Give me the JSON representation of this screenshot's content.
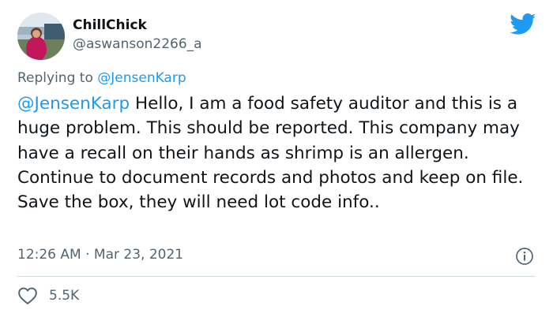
{
  "user": {
    "display_name": "ChillChick",
    "handle": "@aswanson2266_a"
  },
  "reply": {
    "prefix": "Replying to ",
    "mention": "@JensenKarp"
  },
  "tweet": {
    "mention": "@JensenKarp",
    "body": " Hello, I am a food safety auditor and this is a huge problem. This should be reported. This company may have a recall on their hands as shrimp is an allergen. Continue to document records and photos and keep on file.  Save the box, they will need lot code info.."
  },
  "meta": {
    "time": "12:26 AM",
    "separator": " · ",
    "date": "Mar 23, 2021"
  },
  "engagement": {
    "likes": "5.5K"
  },
  "colors": {
    "accent": "#1d9bf0",
    "secondary_text": "#536471",
    "divider": "#cfd9de"
  }
}
